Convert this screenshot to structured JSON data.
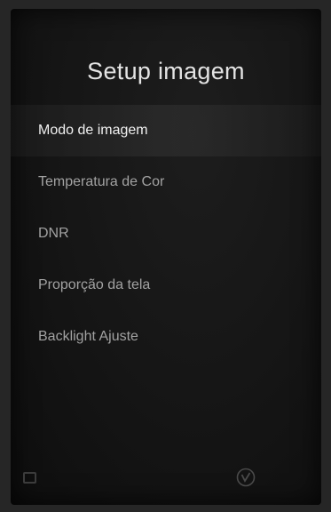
{
  "screen": {
    "title": "Setup imagem"
  },
  "menu": {
    "items": [
      {
        "label": "Modo de imagem",
        "selected": true
      },
      {
        "label": "Temperatura de Cor",
        "selected": false
      },
      {
        "label": "DNR",
        "selected": false
      },
      {
        "label": "Proporção da tela",
        "selected": false
      },
      {
        "label": "Backlight Ajuste",
        "selected": false
      }
    ]
  },
  "footer": {
    "back_icon": "back-icon",
    "ok_icon": "ok-check-icon"
  },
  "colors": {
    "background": "#151515",
    "text_selected": "#f0f0f0",
    "text_normal": "#a2a2a2"
  }
}
